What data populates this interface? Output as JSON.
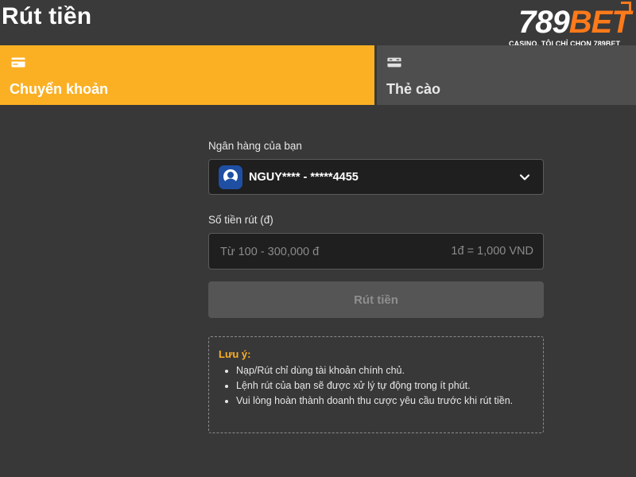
{
  "header": {
    "title": "Rút tiền",
    "logo_mark_number": "789",
    "logo_mark_text": "BET",
    "logo_tagline": "CASINO, TÔI CHỈ CHỌN 789BET"
  },
  "tabs": [
    {
      "label": "Chuyển khoản",
      "icon": "card-icon",
      "active": true
    },
    {
      "label": "Thẻ cào",
      "icon": "scratch-card-icon",
      "active": false
    }
  ],
  "form": {
    "bank_label": "Ngân hàng của bạn",
    "bank_value": "NGUY**** - *****4455",
    "amount_label": "Số tiền rút (đ)",
    "amount_placeholder": "Từ 100 - 300,000 đ",
    "amount_value": "",
    "rate_hint": "1đ = 1,000 VND",
    "submit_label": "Rút tiền"
  },
  "note": {
    "title": "Lưu ý:",
    "items": [
      "Nạp/Rút chỉ dùng tài khoản chính chủ.",
      "Lệnh rút của bạn sẽ được xử lý tự động trong ít phút.",
      "Vui lòng hoàn thành doanh thu cược yêu cầu trước khi rút tiền."
    ]
  },
  "colors": {
    "accent": "#fbb024",
    "brand_orange": "#ff7a1a",
    "background": "#383838",
    "input_bg": "#1f1f1f"
  }
}
